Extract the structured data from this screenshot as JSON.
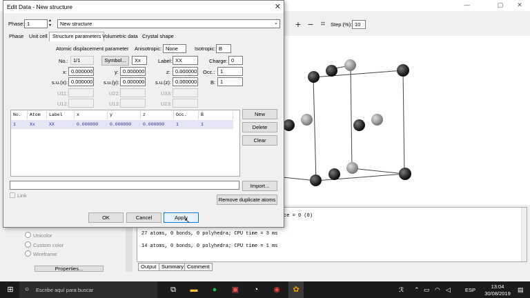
{
  "dialog": {
    "title": "Edit Data - New structure",
    "close_glyph": "✕",
    "phase_label": "Phase:",
    "phase_value": "1",
    "structure_name": "New structure",
    "tabs": [
      "Phase",
      "Unit cell",
      "Structure parameters",
      "Volumetric data",
      "Crystal shape"
    ],
    "atomic_disp_label": "Atomic displacement parameter",
    "anisotropic_label": "Anisotropic:",
    "anisotropic_value": "None",
    "isotropic_label": "Isotropic:",
    "isotropic_value": "B",
    "no_label": "No.:",
    "no_value": "1/1",
    "symbol_button": "Symbol...",
    "symbol_value": "Xx",
    "label_label": "Label:",
    "label_value": "XX",
    "charge_label": "Charge:",
    "charge_value": "0",
    "x_label": "x:",
    "x_value": "0.000000",
    "y_label": "y:",
    "y_value": "0.000000",
    "z_label": "z:",
    "z_value": "0.000000",
    "occ_label": "Occ.:",
    "occ_value": "1",
    "sux_label": "s.u.(x):",
    "sux_value": "0.000000",
    "suy_label": "s.u.(y):",
    "suy_value": "0.000000",
    "suz_label": "s.u.(z):",
    "suz_value": "0.000000",
    "b_label": "B:",
    "b_value": "1",
    "u11": "U11:",
    "u22": "U22:",
    "u33": "U33:",
    "u12": "U12:",
    "u13": "U13:",
    "u23": "U23:",
    "table_headers": [
      "No.",
      "Atom",
      "Label",
      "x",
      "y",
      "z",
      "Occ.",
      "B"
    ],
    "table_row": [
      "1",
      "Xx",
      "XX",
      "0.000000",
      "0.000000",
      "0.000000",
      "1",
      "1"
    ],
    "new_button": "New",
    "delete_button": "Delete",
    "clear_button": "Clear",
    "import_button": "Import...",
    "link_label": "Link",
    "remove_dup_button": "Remove duplicate atoms",
    "ok_button": "OK",
    "cancel_button": "Cancel",
    "apply_button": "Apply"
  },
  "main": {
    "step_label": "Step (%):",
    "step_value": "10",
    "output_lines": [
      "ce = 0 (0)",
      "27 atoms, 0 bonds, 0 polyhedra; CPU time = 3 ms",
      "14 atoms, 0 bonds, 0 polyhedra; CPU time = 1 ms"
    ],
    "bottom_tabs": [
      "Output",
      "Summary",
      "Comment"
    ],
    "radios": [
      "Unicolor",
      "Custom color",
      "Wireframe"
    ],
    "properties_button": "Properties..."
  },
  "taskbar": {
    "search_placeholder": "Escribe aquí para buscar",
    "lang": "ESP",
    "time": "13:04",
    "date": "30/08/2019"
  }
}
